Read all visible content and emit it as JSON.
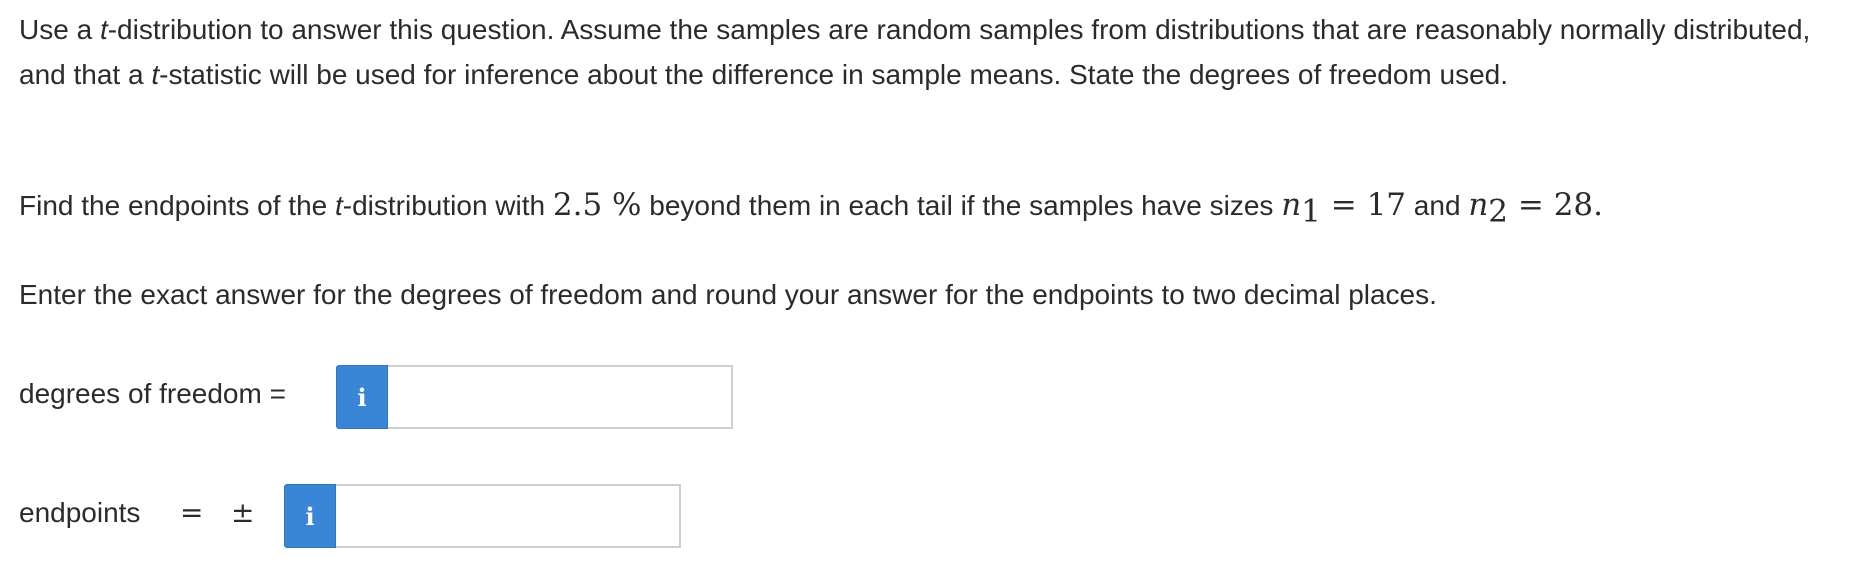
{
  "question": {
    "p1_a": "Use a ",
    "p1_t": "t",
    "p1_b": "-distribution to answer this question. Assume the samples are random samples from distributions that are reasonably normally distributed, and that a ",
    "p1_t2": "t",
    "p1_c": "-statistic will be used for inference about the difference in sample means. State the degrees of freedom used.",
    "p2_a": "Find the endpoints of the ",
    "p2_t": "t",
    "p2_b": "-distribution with ",
    "p2_pct": "2.5 %",
    "p2_c": " beyond them in each tail if the samples have sizes ",
    "n_var": "n",
    "n1_sub": "1",
    "eq1": " = ",
    "n1_val": "17",
    "and": " and ",
    "n2_sub": "2",
    "eq2": " = ",
    "n2_val": "28.",
    "p3": "Enter the exact answer for the degrees of freedom and round your answer for the endpoints to two decimal places."
  },
  "answers": {
    "df_label": "degrees of freedom =",
    "df_info_icon": "i",
    "df_value": "",
    "endpoints_label": "endpoints",
    "endpoints_eq": "=",
    "endpoints_pm": "±",
    "endpoints_info_icon": "i",
    "endpoints_value": ""
  },
  "colors": {
    "info_button": "#3a86d6",
    "input_border": "#cfcfcf",
    "text": "#2b2b2b"
  }
}
